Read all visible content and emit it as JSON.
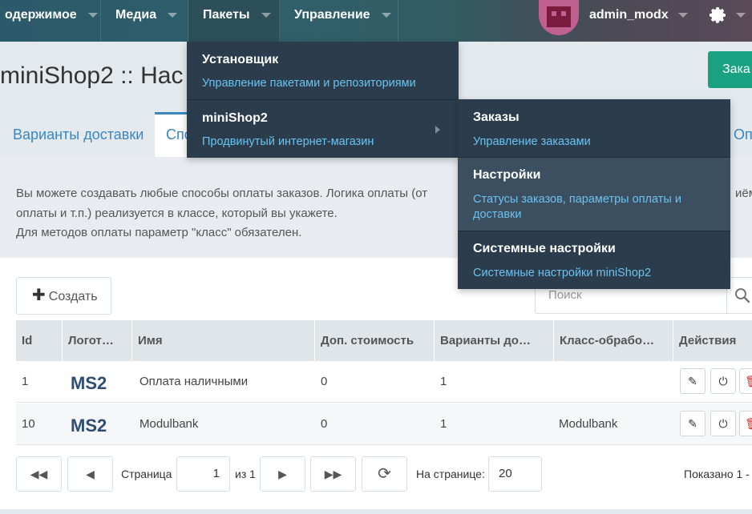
{
  "topnav": {
    "items": [
      "одержимое",
      "Медиа",
      "Пакеты",
      "Управление"
    ],
    "user": "admin_modx",
    "settings_icon": "gear-icon",
    "colors": {
      "bar": "#2f5f6b",
      "active": "#2d4f59"
    }
  },
  "page": {
    "title": "miniShop2 :: Нас",
    "action_button": "Зака"
  },
  "tabs": [
    "Варианты доставки",
    "Спо",
    "Оп"
  ],
  "description": {
    "line1": "Вы можете создавать любые способы оплаты заказов. Логика оплаты (от",
    "line1_overflow": "иём",
    "line2": "оплаты и т.п.) реализуется в классе, который вы укажете.",
    "line3": "Для методов оплаты параметр \"класс\" обязателен."
  },
  "toolbar": {
    "create_label": "Создать",
    "search_placeholder": "Поиск"
  },
  "table": {
    "columns": [
      "Id",
      "Логот…",
      "Имя",
      "Доп. стоимость",
      "Варианты до…",
      "Класс-обрабо…",
      "Действия"
    ],
    "rows": [
      {
        "id": "1",
        "logo": "MS2",
        "name": "Оплата наличными",
        "price": "0",
        "variants": "1",
        "class": ""
      },
      {
        "id": "10",
        "logo": "MS2",
        "name": "Modulbank",
        "price": "0",
        "variants": "1",
        "class": "Modulbank"
      }
    ]
  },
  "pager": {
    "page_label": "Страница",
    "page_value": "1",
    "of_label": "из 1",
    "per_page_label": "На странице:",
    "per_page_value": "20",
    "shown_label": "Показано 1 - "
  },
  "menu_packages": {
    "items": [
      {
        "title": "Установщик",
        "subtitle": "Управление пакетами и репозиториями"
      },
      {
        "title": "miniShop2",
        "subtitle": "Продвинутый интернет-магазин"
      }
    ]
  },
  "menu_minishop": {
    "items": [
      {
        "title": "Заказы",
        "subtitle": "Управление заказами"
      },
      {
        "title": "Настройки",
        "subtitle": "Статусы заказов, параметры оплаты и доставки"
      },
      {
        "title": "Системные настройки",
        "subtitle": "Системные настройки miniShop2"
      }
    ]
  }
}
